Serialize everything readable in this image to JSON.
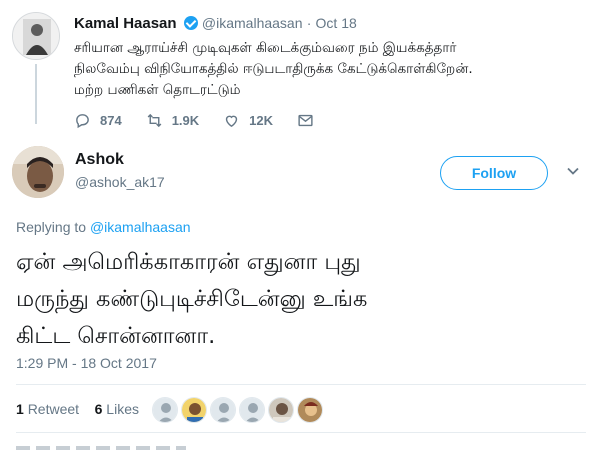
{
  "parent_tweet": {
    "author_name": "Kamal Haasan",
    "handle": "@ikamalhaasan",
    "separator": "·",
    "date": "Oct 18",
    "text_lines": [
      "சரியான ஆராய்ச்சி முடிவுகள் கிடைக்கும்வரை நம் இயக்கத்தார்",
      "நிலவேம்பு விநியோகத்தில் ஈடுபடாதிருக்க கேட்டுக்கொள்கிறேன்.",
      "மற்ற பணிகள் தொடரட்டும்"
    ],
    "actions": {
      "replies": "874",
      "retweets": "1.9K",
      "likes": "12K"
    }
  },
  "main_tweet": {
    "author_name": "Ashok",
    "handle": "@ashok_ak17",
    "follow_label": "Follow",
    "replying_prefix": "Replying to ",
    "replying_to": "@ikamalhaasan",
    "text_lines": [
      "ஏன் அமெரிக்காகாரன் எதுனா புது",
      "மருந்து கண்டுபுடிச்சிடேன்னு உங்க",
      "கிட்ட சொன்னானா."
    ],
    "timestamp": "1:29 PM - 18 Oct 2017",
    "retweet_count": "1",
    "retweet_label": "Retweet",
    "like_count": "6",
    "like_label": "Likes"
  },
  "colors": {
    "accent": "#1da1f2",
    "muted": "#657786",
    "text": "#14171a",
    "divider": "#e6ecf0"
  },
  "icons": [
    "verified-icon",
    "reply-icon",
    "retweet-icon",
    "like-icon",
    "message-icon",
    "chevron-down-icon"
  ]
}
